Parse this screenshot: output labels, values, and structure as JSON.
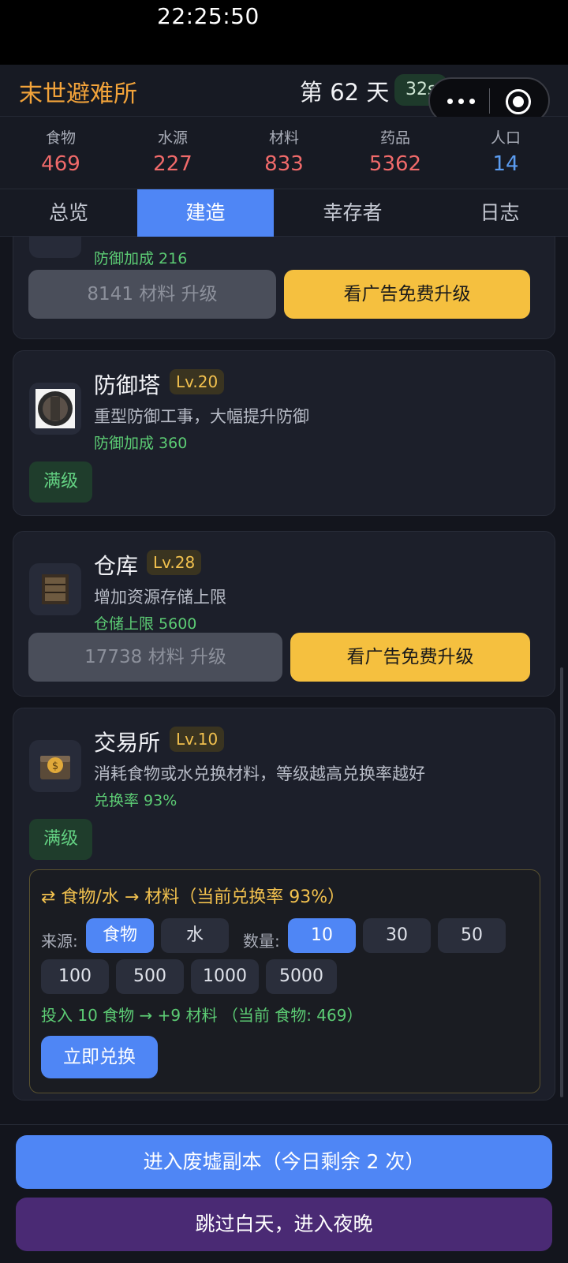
{
  "status_bar": {
    "time": "22:25:50"
  },
  "header": {
    "app_title": "末世避难所",
    "day": "第 62 天",
    "timer": "32s"
  },
  "resources": [
    {
      "label": "食物",
      "value": "469"
    },
    {
      "label": "水源",
      "value": "227"
    },
    {
      "label": "材料",
      "value": "833"
    },
    {
      "label": "药品",
      "value": "5362"
    },
    {
      "label": "人口",
      "value": "14"
    }
  ],
  "tabs": [
    "总览",
    "建造",
    "幸存者",
    "日志"
  ],
  "active_tab": "建造",
  "buildings": {
    "partial": {
      "stat": "防御加成 216",
      "upgrade_label": "8141 材料 升级",
      "ad_label": "看广告免费升级"
    },
    "tower": {
      "name": "防御塔",
      "level": "Lv.20",
      "desc": "重型防御工事，大幅提升防御",
      "stat": "防御加成 360",
      "max_label": "满级"
    },
    "warehouse": {
      "name": "仓库",
      "level": "Lv.28",
      "desc": "增加资源存储上限",
      "stat": "仓储上限 5600",
      "upgrade_label": "17738 材料 升级",
      "ad_label": "看广告免费升级"
    },
    "exchange": {
      "name": "交易所",
      "level": "Lv.10",
      "desc": "消耗食物或水兑换材料，等级越高兑换率越好",
      "stat": "兑换率 93%",
      "max_label": "满级"
    }
  },
  "exchange_panel": {
    "title": "⇄ 食物/水 → 材料（当前兑换率 93%）",
    "source_label": "来源:",
    "sources": [
      "食物",
      "水"
    ],
    "selected_source": "食物",
    "qty_label": "数量:",
    "quantities": [
      "10",
      "30",
      "50",
      "100",
      "500",
      "1000",
      "5000"
    ],
    "selected_qty": "10",
    "preview": "投入 10 食物 → +9 材料 （当前 食物: 469）",
    "confirm_label": "立即兑换"
  },
  "footer": {
    "ruins_button": "进入废墟副本（今日剩余 2 次）",
    "skip_button": "跳过白天，进入夜晚"
  },
  "colors": {
    "accent_blue": "#4f86f5",
    "ad_yellow": "#f5c03f",
    "title_orange": "#f2a33a",
    "stat_green": "#5ccc74",
    "resource_red": "#f06a6a",
    "night_purple": "#4a2a74"
  }
}
